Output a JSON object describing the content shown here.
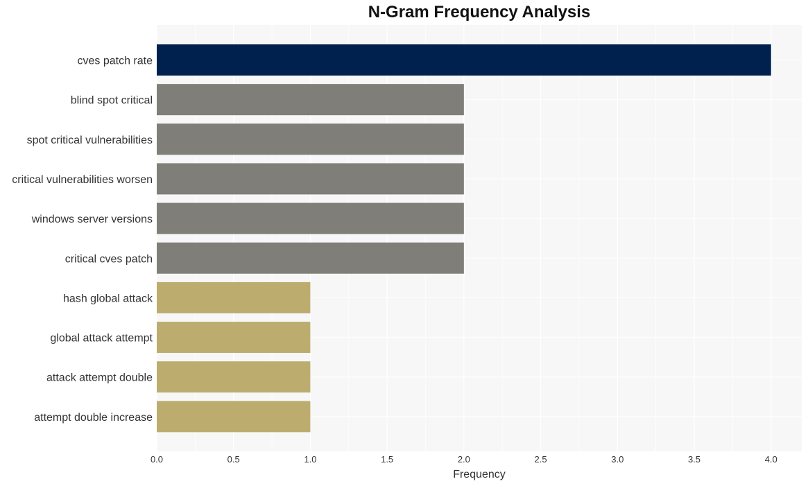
{
  "chart_data": {
    "type": "bar",
    "orientation": "horizontal",
    "title": "N-Gram Frequency Analysis",
    "xlabel": "Frequency",
    "ylabel": "",
    "xlim": [
      0,
      4.2
    ],
    "grid": true,
    "xticks": [
      "0.0",
      "0.5",
      "1.0",
      "1.5",
      "2.0",
      "2.5",
      "3.0",
      "3.5",
      "4.0"
    ],
    "xtick_values": [
      0,
      0.5,
      1.0,
      1.5,
      2.0,
      2.5,
      3.0,
      3.5,
      4.0
    ],
    "categories": [
      "cves patch rate",
      "blind spot critical",
      "spot critical vulnerabilities",
      "critical vulnerabilities worsen",
      "windows server versions",
      "critical cves patch",
      "hash global attack",
      "global attack attempt",
      "attack attempt double",
      "attempt double increase"
    ],
    "values": [
      4,
      2,
      2,
      2,
      2,
      2,
      1,
      1,
      1,
      1
    ],
    "colors": [
      "#00214d",
      "#7f7e79",
      "#7f7e79",
      "#7f7e79",
      "#7f7e79",
      "#7f7e79",
      "#bcad6f",
      "#bcad6f",
      "#bcad6f",
      "#bcad6f"
    ],
    "plot_background": "#f7f7f7",
    "grid_color": "#ffffff"
  }
}
